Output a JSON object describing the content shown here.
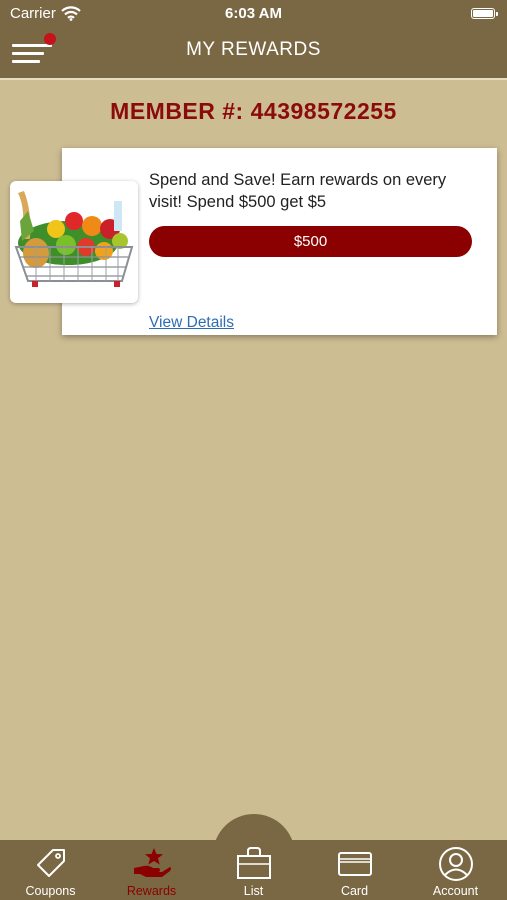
{
  "status_bar": {
    "carrier": "Carrier",
    "time": "6:03 AM"
  },
  "header": {
    "title": "MY REWARDS",
    "menu_icon": "hamburger-menu-icon",
    "notification_color": "#c4131b"
  },
  "member": {
    "label": "MEMBER #: 44398572255"
  },
  "reward": {
    "image": "grocery-basket-image",
    "description": "Spend and Save! Earn rewards on every visit! Spend $500 get $5",
    "amount": "$500",
    "details_link": "View Details"
  },
  "tabs": [
    {
      "label": "Coupons",
      "icon": "tag-icon",
      "active": false
    },
    {
      "label": "Rewards",
      "icon": "hand-star-icon",
      "active": true
    },
    {
      "label": "List",
      "icon": "shopping-bag-icon",
      "active": false
    },
    {
      "label": "Card",
      "icon": "card-icon",
      "active": false
    },
    {
      "label": "Account",
      "icon": "user-circle-icon",
      "active": false
    }
  ],
  "colors": {
    "bar": "#7a6844",
    "background": "#cdbd93",
    "accent": "#8b0000",
    "link": "#2f6db3"
  }
}
